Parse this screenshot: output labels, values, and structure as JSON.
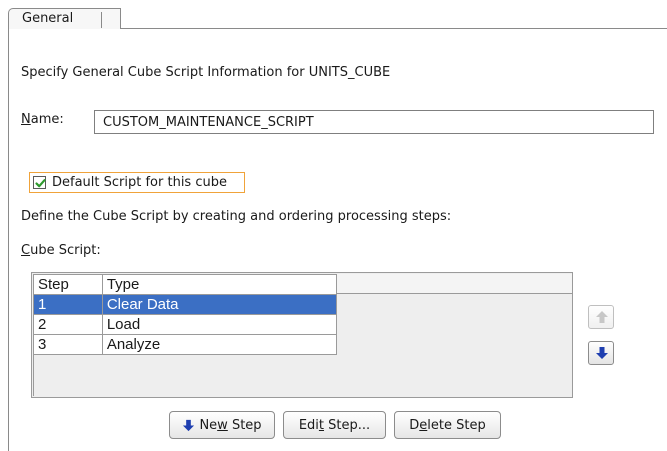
{
  "tabs": [
    {
      "label": "General"
    }
  ],
  "intro": "Specify General Cube Script Information for UNITS_CUBE",
  "name_field": {
    "label_first": "N",
    "label_rest": "ame:",
    "value": "CUSTOM_MAINTENANCE_SCRIPT"
  },
  "default_checkbox": {
    "label": "Default Script for this cube",
    "checked": true
  },
  "define_text": "Define the Cube Script by creating and ordering processing steps:",
  "cube_script_label": {
    "first": "C",
    "rest": "ube Script:"
  },
  "table": {
    "columns": [
      "Step",
      "Type"
    ],
    "rows": [
      {
        "step": "1",
        "type": "Clear Data",
        "selected": true
      },
      {
        "step": "2",
        "type": "Load",
        "selected": false
      },
      {
        "step": "3",
        "type": "Analyze",
        "selected": false
      }
    ]
  },
  "buttons": {
    "new_step": {
      "a": "Ne",
      "u": "w",
      "b": " Step"
    },
    "edit_step": {
      "a": "Edi",
      "u": "t",
      "b": " Step..."
    },
    "delete_step": {
      "a": "D",
      "u": "e",
      "b": "lete Step"
    }
  },
  "icons": {
    "move_up": "up-arrow-icon",
    "move_down": "down-arrow-icon",
    "new_step": "down-arrow-icon",
    "check": "check-icon"
  },
  "colors": {
    "selection": "#3b6fc4",
    "arrow_blue": "#1f3fb0",
    "check_green": "#2e9a2e",
    "focus_orange": "#f0a33a"
  }
}
